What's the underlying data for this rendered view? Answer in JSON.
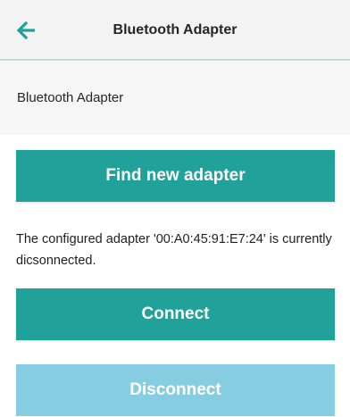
{
  "app_bar": {
    "title": "Bluetooth Adapter",
    "back_icon": "arrow-left-icon",
    "accent_color": "#20a19a"
  },
  "section": {
    "header": "Bluetooth Adapter"
  },
  "actions": {
    "find_label": "Find new adapter",
    "connect_label": "Connect",
    "disconnect_label": "Disconnect"
  },
  "status": {
    "message": "The configured adapter '00:A0:45:91:E7:24' is currently dicsonnected."
  },
  "colors": {
    "primary_button": "#20a19a",
    "disabled_button": "#86cde2",
    "header_background": "#f3f3f3"
  }
}
